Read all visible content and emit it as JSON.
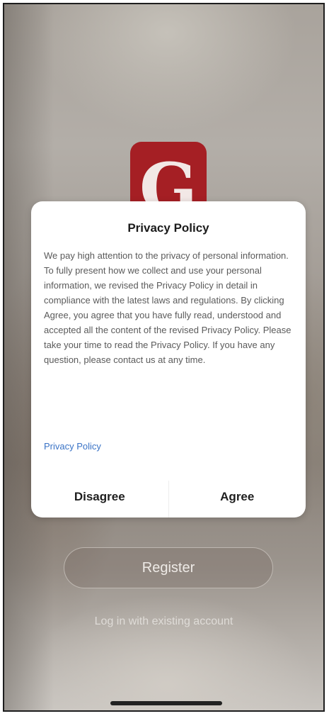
{
  "app": {
    "logo_letter": "G",
    "brand_color": "#a51f24"
  },
  "background_actions": {
    "register_label": "Register",
    "login_link": "Log in with existing account"
  },
  "privacy_dialog": {
    "title": "Privacy Policy",
    "body": "We pay high attention to the privacy of personal information. To fully present how we collect and use your personal information, we revised the Privacy Policy in detail in compliance with the latest laws and regulations. By clicking Agree, you agree that you have fully read, understood and accepted all the content of the revised Privacy Policy. Please take your time to read the Privacy Policy. If you have any question, please contact us at any time.",
    "link_label": "Privacy Policy",
    "link_color": "#3a73c6",
    "disagree_label": "Disagree",
    "agree_label": "Agree"
  }
}
